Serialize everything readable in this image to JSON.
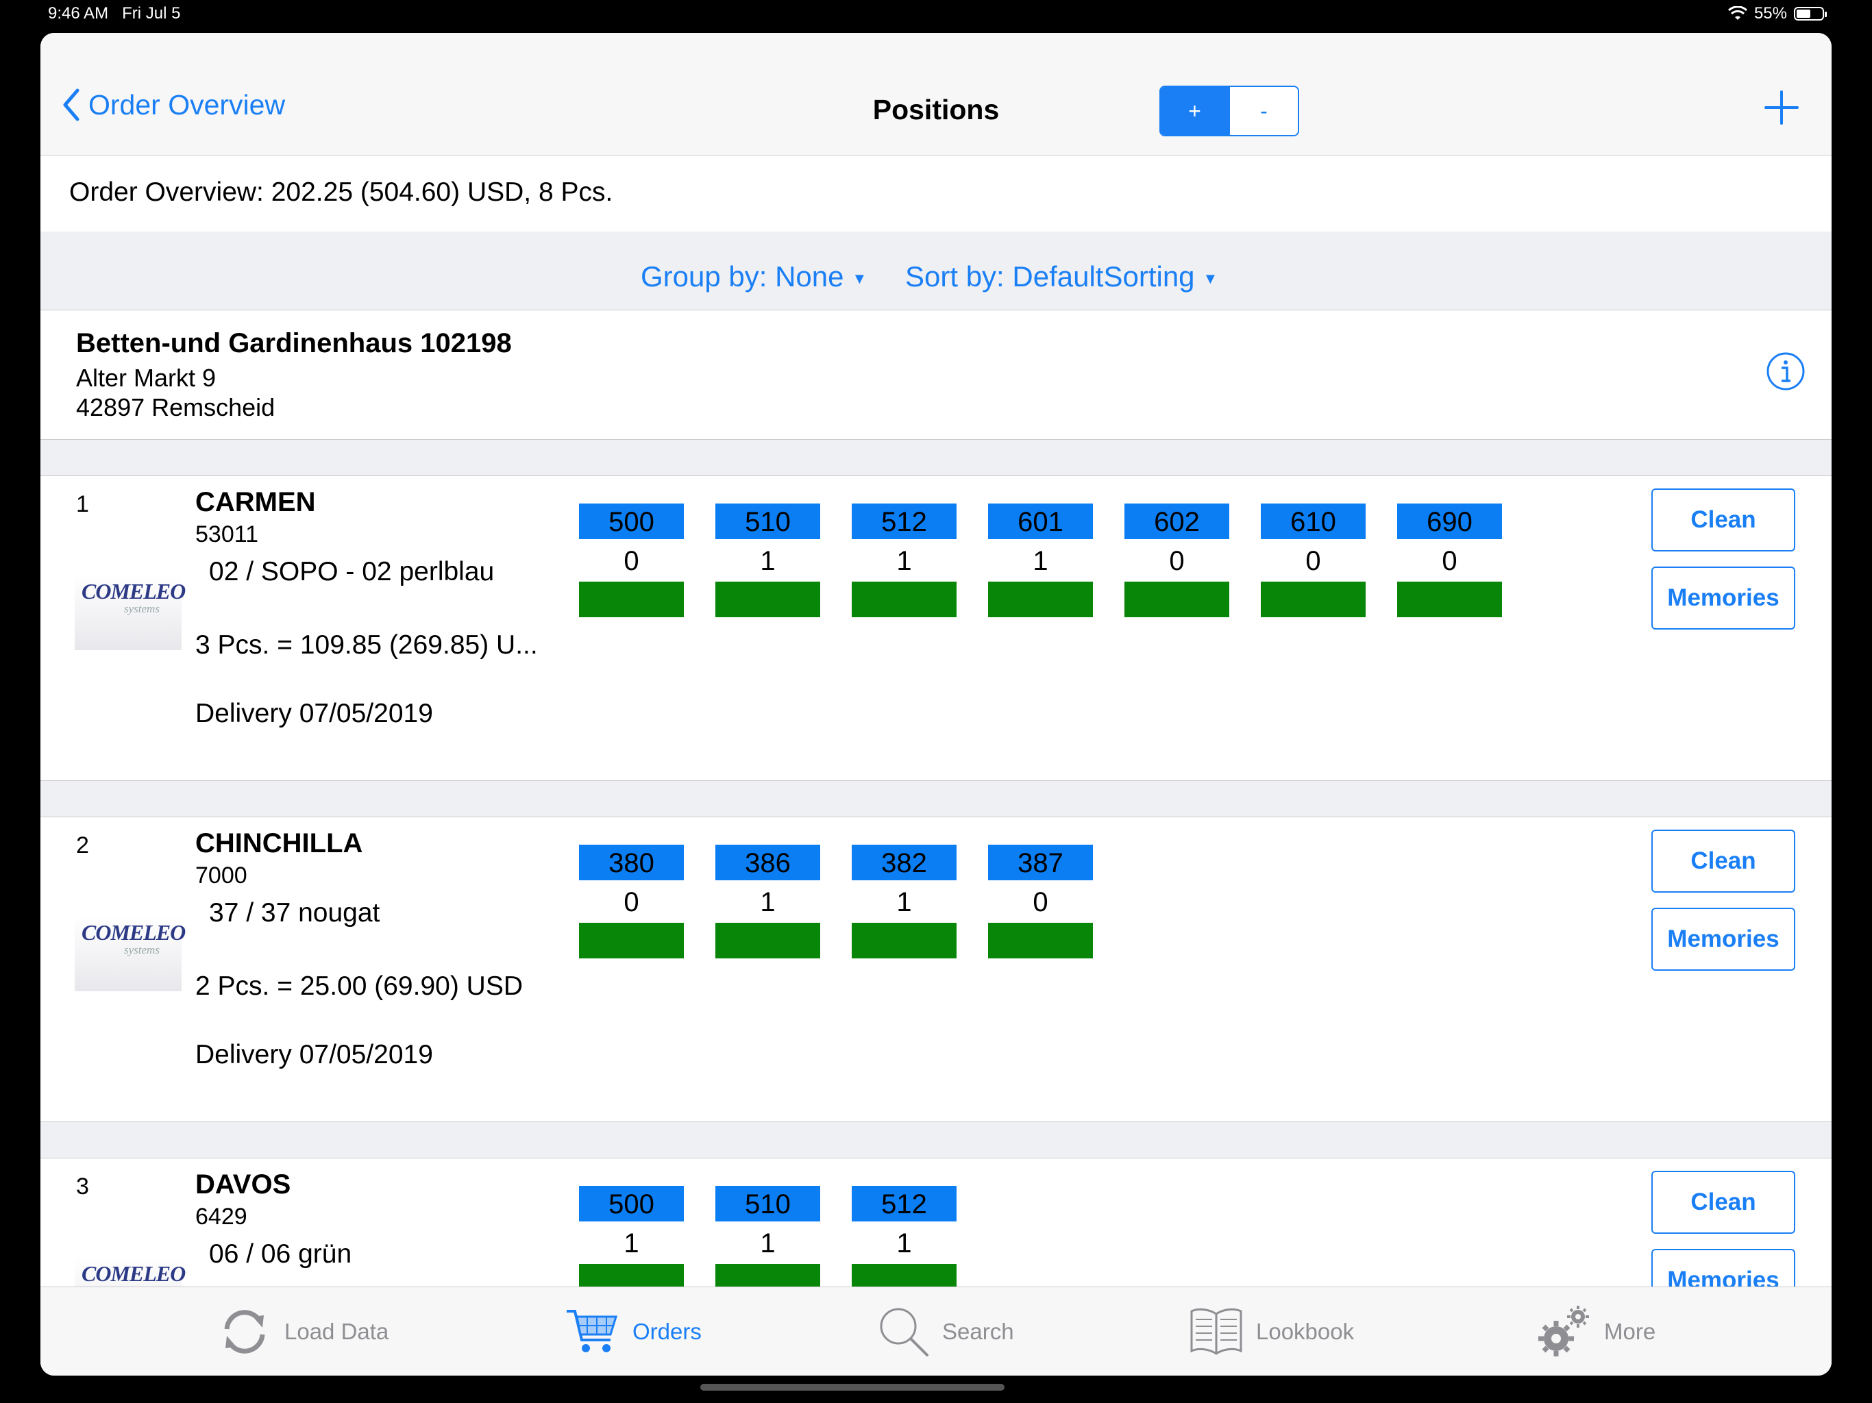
{
  "status_bar": {
    "time": "9:46 AM",
    "date": "Fri Jul 5",
    "battery": "55%"
  },
  "nav": {
    "back_label": "Order Overview",
    "title": "Positions",
    "seg_plus": "+",
    "seg_minus": "-"
  },
  "summary": "Order Overview: 202.25 (504.60) USD, 8 Pcs.",
  "filters": {
    "group": "Group by: None",
    "sort": "Sort by: DefaultSorting"
  },
  "customer": {
    "name": "Betten-und Gardinenhaus 102198",
    "street": "Alter Markt 9",
    "city": "42897 Remscheid"
  },
  "logo": {
    "brand": "COMELEO",
    "sub": "systems"
  },
  "actions": {
    "clean": "Clean",
    "memories": "Memories"
  },
  "positions": [
    {
      "num": "1",
      "name": "CARMEN",
      "article": "53011",
      "variant": "02 / SOPO - 02 perlblau",
      "price": "3 Pcs. = 109.85 (269.85) U...",
      "delivery": "Delivery 07/05/2019",
      "sizes": [
        {
          "label": "500",
          "qty": "0"
        },
        {
          "label": "510",
          "qty": "1"
        },
        {
          "label": "512",
          "qty": "1"
        },
        {
          "label": "601",
          "qty": "1"
        },
        {
          "label": "602",
          "qty": "0"
        },
        {
          "label": "610",
          "qty": "0"
        },
        {
          "label": "690",
          "qty": "0"
        }
      ]
    },
    {
      "num": "2",
      "name": "CHINCHILLA",
      "article": "7000",
      "variant": "37 / 37 nougat",
      "price": "2 Pcs. = 25.00 (69.90) USD",
      "delivery": "Delivery 07/05/2019",
      "sizes": [
        {
          "label": "380",
          "qty": "0"
        },
        {
          "label": "386",
          "qty": "1"
        },
        {
          "label": "382",
          "qty": "1"
        },
        {
          "label": "387",
          "qty": "0"
        }
      ]
    },
    {
      "num": "3",
      "name": "DAVOS",
      "article": "6429",
      "variant": "06 / 06 grün",
      "price": "",
      "delivery": "",
      "sizes": [
        {
          "label": "500",
          "qty": "1"
        },
        {
          "label": "510",
          "qty": "1"
        },
        {
          "label": "512",
          "qty": "1"
        }
      ]
    }
  ],
  "tabs": [
    {
      "label": "Load Data",
      "icon": "reload-icon"
    },
    {
      "label": "Orders",
      "icon": "cart-icon",
      "active": true
    },
    {
      "label": "Search",
      "icon": "search-icon"
    },
    {
      "label": "Lookbook",
      "icon": "book-icon"
    },
    {
      "label": "More",
      "icon": "gear-icon"
    }
  ],
  "colors": {
    "accent": "#1a7ff5",
    "size_label": "#0b7ef4",
    "stock_bar": "#078607"
  }
}
